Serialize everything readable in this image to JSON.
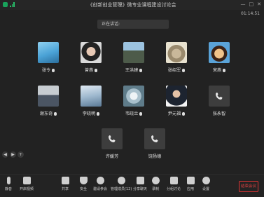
{
  "window": {
    "title": "《创新创业管理》微专业课程建设讨论会",
    "time": "01:14:51",
    "controls": [
      "—",
      "□",
      "✕"
    ]
  },
  "speaking_label": "正在讲话:",
  "participants": [
    {
      "name": "张令",
      "mic": true
    },
    {
      "name": "曾燕",
      "mic": true
    },
    {
      "name": "王洪建",
      "mic": true
    },
    {
      "name": "张绍军",
      "mic": true
    },
    {
      "name": "宋燕",
      "mic": true
    },
    {
      "name": "谢东奇",
      "mic": true
    },
    {
      "name": "李晓明",
      "mic": true
    },
    {
      "name": "韦晓兰",
      "mic": true
    },
    {
      "name": "尹元福",
      "mic": true
    },
    {
      "name": "张永智",
      "mic": false
    },
    {
      "name": "许媛芳",
      "mic": false
    },
    {
      "name": "饶扬德",
      "mic": false
    }
  ],
  "side_controls": [
    "◀",
    "▶",
    "+"
  ],
  "toolbar": {
    "items": [
      {
        "label": "静音",
        "icon": "mic-icon"
      },
      {
        "label": "开启视频",
        "icon": "camera-off-icon"
      },
      {
        "label": "共享",
        "icon": "share-screen-icon"
      },
      {
        "label": "安全",
        "icon": "shield-icon"
      },
      {
        "label": "邀请参会",
        "icon": "add-user-icon"
      },
      {
        "label": "管理成员(12)",
        "icon": "members-icon"
      },
      {
        "label": "分享聊天",
        "icon": "chat-icon"
      },
      {
        "label": "录制",
        "icon": "record-icon"
      },
      {
        "label": "分组讨论",
        "icon": "breakout-icon"
      },
      {
        "label": "应用",
        "icon": "apps-icon"
      },
      {
        "label": "设置",
        "icon": "settings-icon"
      }
    ],
    "end_label": "结束会议"
  }
}
